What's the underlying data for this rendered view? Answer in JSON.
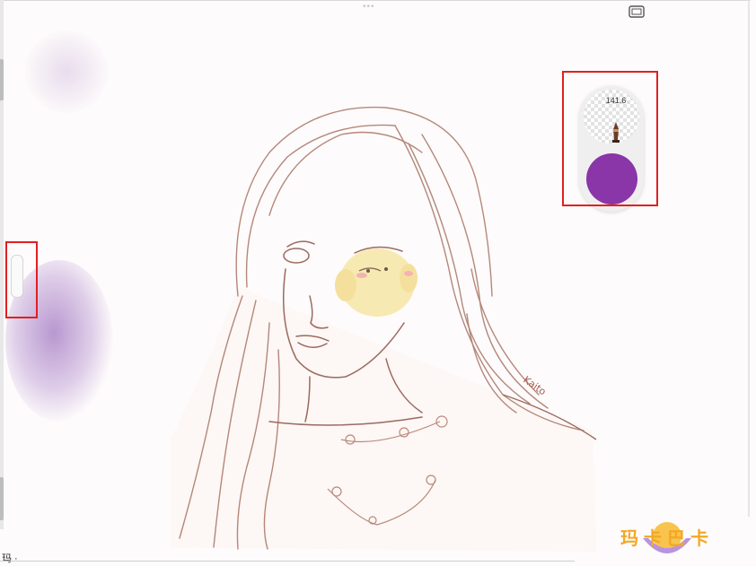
{
  "canvas": {
    "brush_size_label": "141.6",
    "current_color": "#8a35a8",
    "signature_text": "Kaito"
  },
  "toolbar": {
    "fullscreen_icon": "fullscreen-icon",
    "drag_handle_icon": "drag-dots-icon",
    "brush_icon": "brush-nib-icon"
  },
  "footer": {
    "partial_text": "玛 ·"
  },
  "watermark": {
    "logo_text": "玛卡巴卡"
  },
  "colors": {
    "highlight": "#e02020",
    "accent_purple": "#8a35a8",
    "sketch_line": "#9b6a5f"
  }
}
